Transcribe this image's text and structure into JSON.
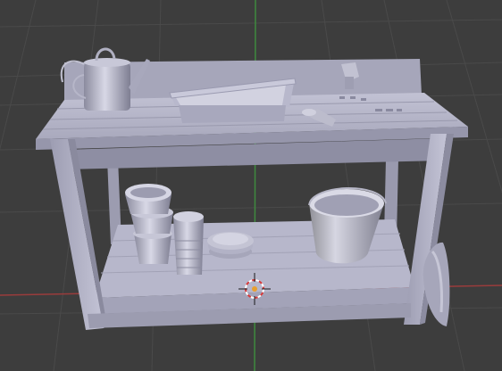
{
  "viewport": {
    "background": "#3d3d3d",
    "grid_color": "#4a4a4a",
    "x_axis_color": "#9a3c3c",
    "y_axis_color": "#3f8a3f"
  },
  "scene": {
    "object_color": "#b4b4c8",
    "objects": [
      "watering-can",
      "wash-tub",
      "trowel",
      "hand-fork",
      "flower-pot-stack",
      "plate-stack",
      "tall-pot-stack",
      "bucket",
      "sack",
      "garden-bench"
    ]
  },
  "cursor": {
    "icon": "3d-cursor-icon",
    "ring_color_a": "#d83a3a",
    "ring_color_b": "#ffffff"
  }
}
